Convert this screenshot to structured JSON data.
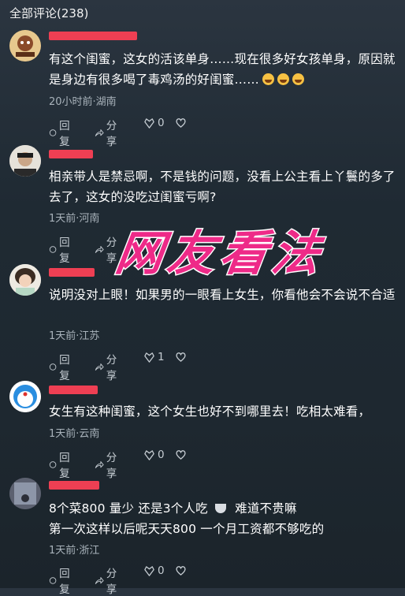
{
  "header": {
    "title": "全部评论(238)"
  },
  "overlay_text": "网友看法",
  "comments": [
    {
      "text": "有这个闺蜜，这女的活该单身……现在很多好女孩单身，原因就是身边有很多喝了毒鸡汤的好闺蜜……",
      "meta": "20小时前·湖南",
      "reply": "回复",
      "share": "分享",
      "likes": "0"
    },
    {
      "text": "相亲带人是禁忌啊，不是钱的问题，没看上公主看上丫鬟的多了去了，这女的没吃过闺蜜亏啊?",
      "meta": "1天前·河南",
      "reply": "回复",
      "share": "分享",
      "likes": ""
    },
    {
      "text": "说明没对上眼！如果男的一眼看上女生，你看他会不会说不合适",
      "meta": "1天前·江苏",
      "reply": "回复",
      "share": "分享",
      "likes": "1"
    },
    {
      "text": "女生有这种闺蜜，这个女生也好不到哪里去！吃相太难看，",
      "meta": "1天前·云南",
      "reply": "回复",
      "share": "分享",
      "likes": "0"
    },
    {
      "text_line1": "8个菜800 量少 还是3个人吃",
      "text_line1b": "难道不贵嘛",
      "text_line2": "第一次这样以后呢天天800 一个月工资都不够吃的",
      "meta": "1天前·浙江",
      "reply": "回复",
      "share": "分享",
      "likes": "0"
    }
  ],
  "colors": {
    "name_redaction": "#ee3f53",
    "overlay": "#ee2a88"
  }
}
